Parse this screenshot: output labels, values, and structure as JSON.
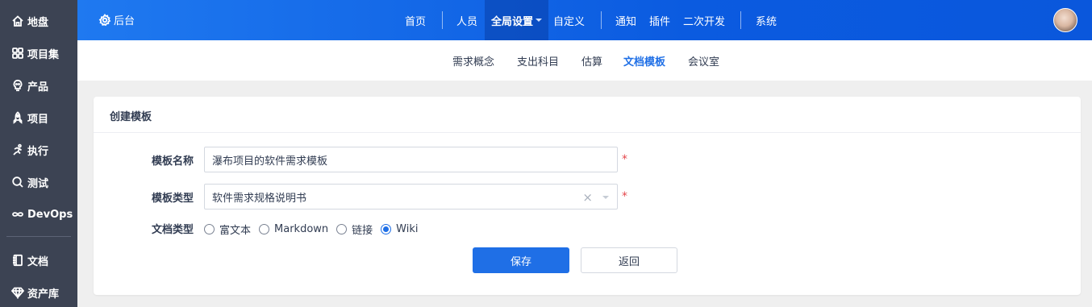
{
  "sidebar": {
    "items": [
      {
        "label": "地盘",
        "icon": "home-icon"
      },
      {
        "label": "项目集",
        "icon": "grid-icon"
      },
      {
        "label": "产品",
        "icon": "bulb-icon"
      },
      {
        "label": "项目",
        "icon": "rocket-icon"
      },
      {
        "label": "执行",
        "icon": "run-icon"
      },
      {
        "label": "测试",
        "icon": "search-icon"
      },
      {
        "label": "DevOps",
        "icon": "infinity-icon"
      }
    ],
    "bottom_items": [
      {
        "label": "文档",
        "icon": "notebook-icon"
      },
      {
        "label": "资产库",
        "icon": "diamond-icon"
      }
    ]
  },
  "header": {
    "brand": "后台",
    "brand_icon": "gear-icon",
    "nav": {
      "home": "首页",
      "people": "人员",
      "global_settings": "全局设置",
      "custom": "自定义",
      "notify": "通知",
      "plugin": "插件",
      "secondary_dev": "二次开发",
      "system": "系统"
    }
  },
  "subnav": {
    "items": [
      "需求概念",
      "支出科目",
      "估算",
      "文档模板",
      "会议室"
    ],
    "active": "文档模板"
  },
  "panel": {
    "title": "创建模板",
    "fields": {
      "name_label": "模板名称",
      "name_value": "瀑布项目的软件需求模板",
      "type_label": "模板类型",
      "type_value": "软件需求规格说明书",
      "doc_type_label": "文档类型",
      "required_mark": "*",
      "clear_mark": "×"
    },
    "doc_types": [
      "富文本",
      "Markdown",
      "链接",
      "Wiki"
    ],
    "doc_type_selected": "Wiki",
    "buttons": {
      "save": "保存",
      "back": "返回"
    }
  },
  "colors": {
    "accent": "#1f6fe6",
    "sidebar": "#3c4353",
    "required": "#e5484d"
  }
}
